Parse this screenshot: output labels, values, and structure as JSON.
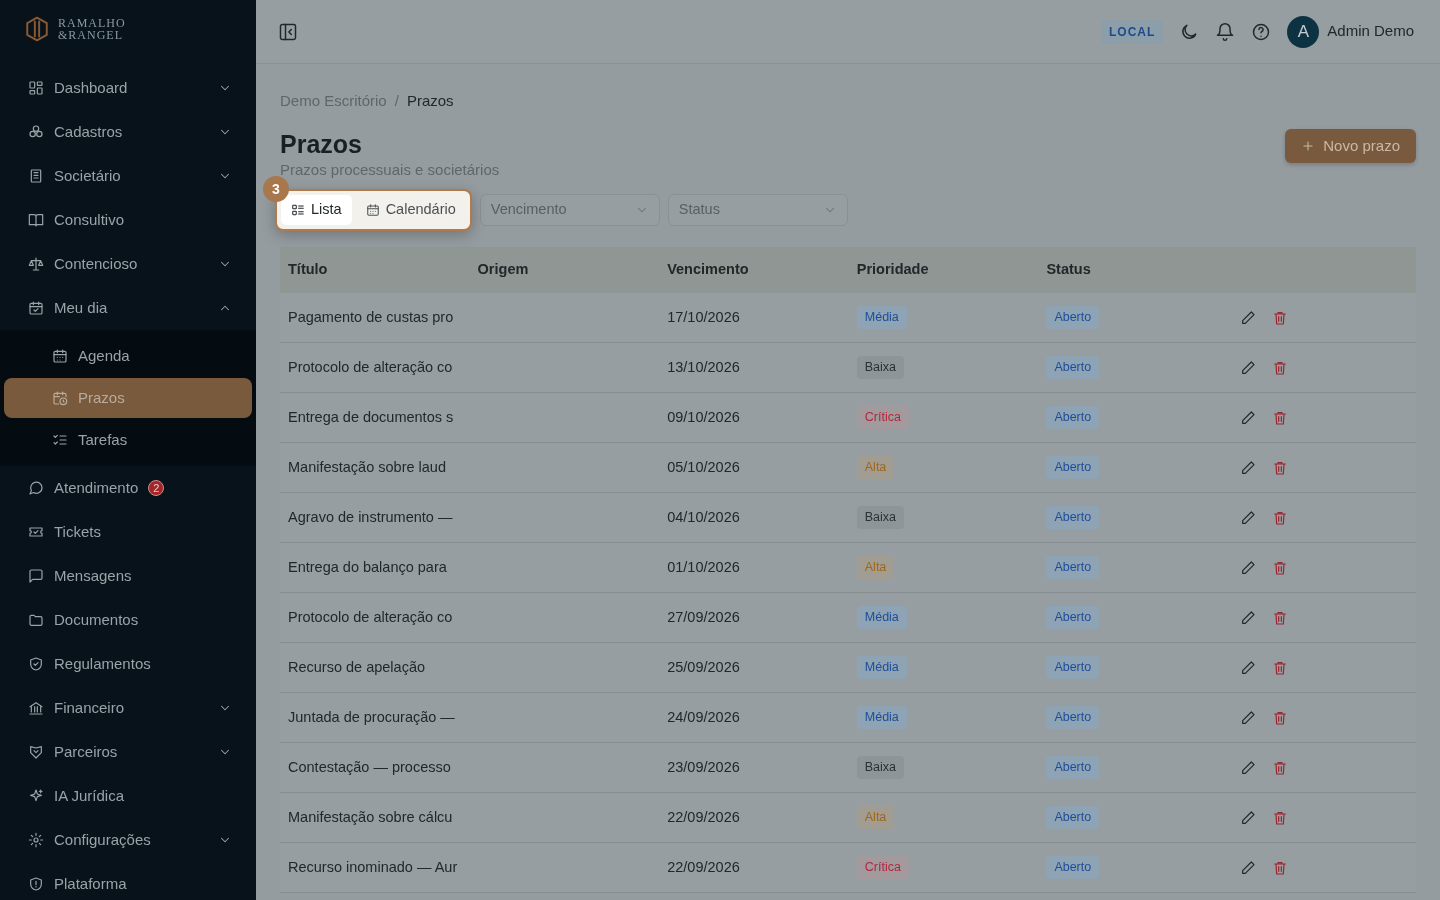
{
  "brand": {
    "line1": "RAMALHO",
    "line2": "&RANGEL"
  },
  "sidebar": {
    "items": [
      {
        "label": "Dashboard",
        "expanded": false,
        "selected": false
      },
      {
        "label": "Cadastros",
        "expanded": false,
        "selected": false
      },
      {
        "label": "Societário",
        "expanded": false,
        "selected": false
      },
      {
        "label": "Consultivo",
        "selected": false
      },
      {
        "label": "Contencioso",
        "expanded": false,
        "selected": false
      },
      {
        "label": "Meu dia",
        "expanded": true,
        "selected": false,
        "children": [
          {
            "label": "Agenda",
            "selected": false
          },
          {
            "label": "Prazos",
            "selected": true
          },
          {
            "label": "Tarefas",
            "selected": false
          }
        ]
      },
      {
        "label": "Atendimento",
        "badge": "2",
        "selected": false
      },
      {
        "label": "Tickets",
        "selected": false
      },
      {
        "label": "Mensagens",
        "selected": false
      },
      {
        "label": "Documentos",
        "selected": false
      },
      {
        "label": "Regulamentos",
        "selected": false
      },
      {
        "label": "Financeiro",
        "expanded": false,
        "selected": false
      },
      {
        "label": "Parceiros",
        "expanded": false,
        "selected": false
      },
      {
        "label": "IA Jurídica",
        "selected": false
      },
      {
        "label": "Configurações",
        "expanded": false,
        "selected": false
      },
      {
        "label": "Plataforma",
        "selected": false
      }
    ]
  },
  "topbar": {
    "env_badge": "LOCAL",
    "user": {
      "initial": "A",
      "name": "Admin Demo"
    }
  },
  "breadcrumb": {
    "separator": "/",
    "items": [
      {
        "label": "Demo Escritório",
        "current": false
      },
      {
        "label": "Prazos",
        "current": true
      }
    ]
  },
  "page": {
    "title": "Prazos",
    "subtitle": "Prazos processuais e societários",
    "new_button": "Novo prazo"
  },
  "tour": {
    "step": "3"
  },
  "view_toggle": [
    {
      "label": "Lista",
      "selected": true
    },
    {
      "label": "Calendário",
      "selected": false
    }
  ],
  "filters": [
    {
      "placeholder": "Vencimento"
    },
    {
      "placeholder": "Status"
    }
  ],
  "table": {
    "columns": [
      "Título",
      "Origem",
      "Vencimento",
      "Prioridade",
      "Status"
    ],
    "rows": [
      {
        "title": "Pagamento de custas pro",
        "due": "17/10/2026",
        "priority": {
          "label": "Média",
          "kind": "medium"
        },
        "status": {
          "label": "Aberto",
          "kind": "open"
        }
      },
      {
        "title": "Protocolo de alteração co",
        "due": "13/10/2026",
        "priority": {
          "label": "Baixa",
          "kind": "low"
        },
        "status": {
          "label": "Aberto",
          "kind": "open"
        }
      },
      {
        "title": "Entrega de documentos s",
        "due": "09/10/2026",
        "priority": {
          "label": "Crítica",
          "kind": "critical"
        },
        "status": {
          "label": "Aberto",
          "kind": "open"
        }
      },
      {
        "title": "Manifestação sobre laud",
        "due": "05/10/2026",
        "priority": {
          "label": "Alta",
          "kind": "high"
        },
        "status": {
          "label": "Aberto",
          "kind": "open"
        }
      },
      {
        "title": "Agravo de instrumento —",
        "due": "04/10/2026",
        "priority": {
          "label": "Baixa",
          "kind": "low"
        },
        "status": {
          "label": "Aberto",
          "kind": "open"
        }
      },
      {
        "title": "Entrega do balanço para",
        "due": "01/10/2026",
        "priority": {
          "label": "Alta",
          "kind": "high"
        },
        "status": {
          "label": "Aberto",
          "kind": "open"
        }
      },
      {
        "title": "Protocolo de alteração co",
        "due": "27/09/2026",
        "priority": {
          "label": "Média",
          "kind": "medium"
        },
        "status": {
          "label": "Aberto",
          "kind": "open"
        }
      },
      {
        "title": "Recurso de apelação",
        "due": "25/09/2026",
        "priority": {
          "label": "Média",
          "kind": "medium"
        },
        "status": {
          "label": "Aberto",
          "kind": "open"
        }
      },
      {
        "title": "Juntada de procuração —",
        "due": "24/09/2026",
        "priority": {
          "label": "Média",
          "kind": "medium"
        },
        "status": {
          "label": "Aberto",
          "kind": "open"
        }
      },
      {
        "title": "Contestação — processo",
        "due": "23/09/2026",
        "priority": {
          "label": "Baixa",
          "kind": "low"
        },
        "status": {
          "label": "Aberto",
          "kind": "open"
        }
      },
      {
        "title": "Manifestação sobre cálcu",
        "due": "22/09/2026",
        "priority": {
          "label": "Alta",
          "kind": "high"
        },
        "status": {
          "label": "Aberto",
          "kind": "open"
        }
      },
      {
        "title": "Recurso inominado — Aur",
        "due": "22/09/2026",
        "priority": {
          "label": "Crítica",
          "kind": "critical"
        },
        "status": {
          "label": "Aberto",
          "kind": "open"
        }
      }
    ]
  }
}
